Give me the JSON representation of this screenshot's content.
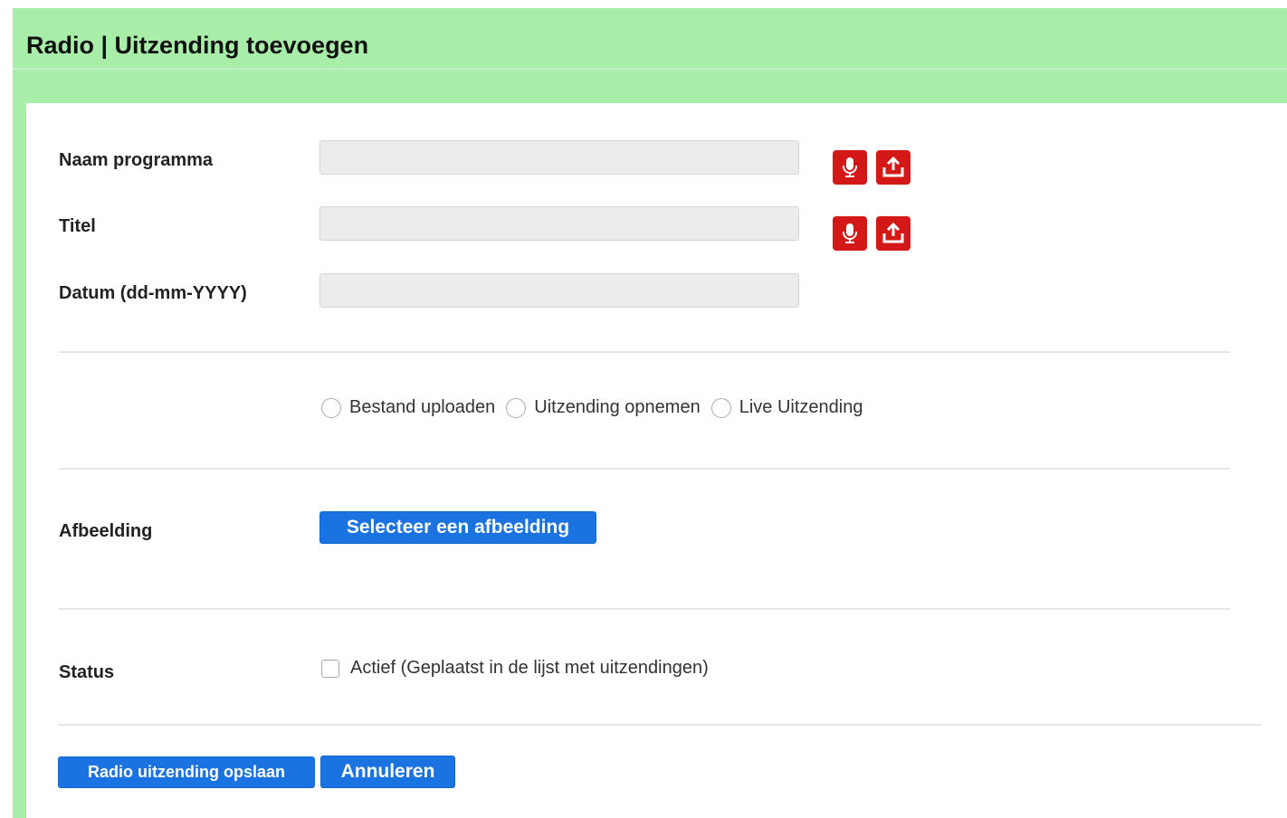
{
  "header": {
    "title": "Radio | Uitzending toevoegen"
  },
  "form": {
    "program_name": {
      "label": "Naam programma",
      "value": ""
    },
    "title": {
      "label": "Titel",
      "value": ""
    },
    "date": {
      "label": "Datum (dd-mm-YYYY)",
      "value": ""
    },
    "source_options": [
      {
        "label": "Bestand uploaden",
        "checked": false
      },
      {
        "label": "Uitzending opnemen",
        "checked": false
      },
      {
        "label": "Live Uitzending",
        "checked": false
      }
    ],
    "image": {
      "label": "Afbeelding",
      "button_label": "Selecteer een afbeelding"
    },
    "status": {
      "label": "Status",
      "checkbox_label": "Actief (Geplaatst in de lijst met uitzendingen)",
      "checked": false
    }
  },
  "actions": {
    "save_label": "Radio uitzending opslaan",
    "cancel_label": "Annuleren"
  },
  "icons": {
    "record": "microphone-icon",
    "upload": "upload-icon"
  },
  "colors": {
    "header_bg": "#a8eda8",
    "icon_red": "#d41717",
    "button_blue": "#1a73e0"
  }
}
